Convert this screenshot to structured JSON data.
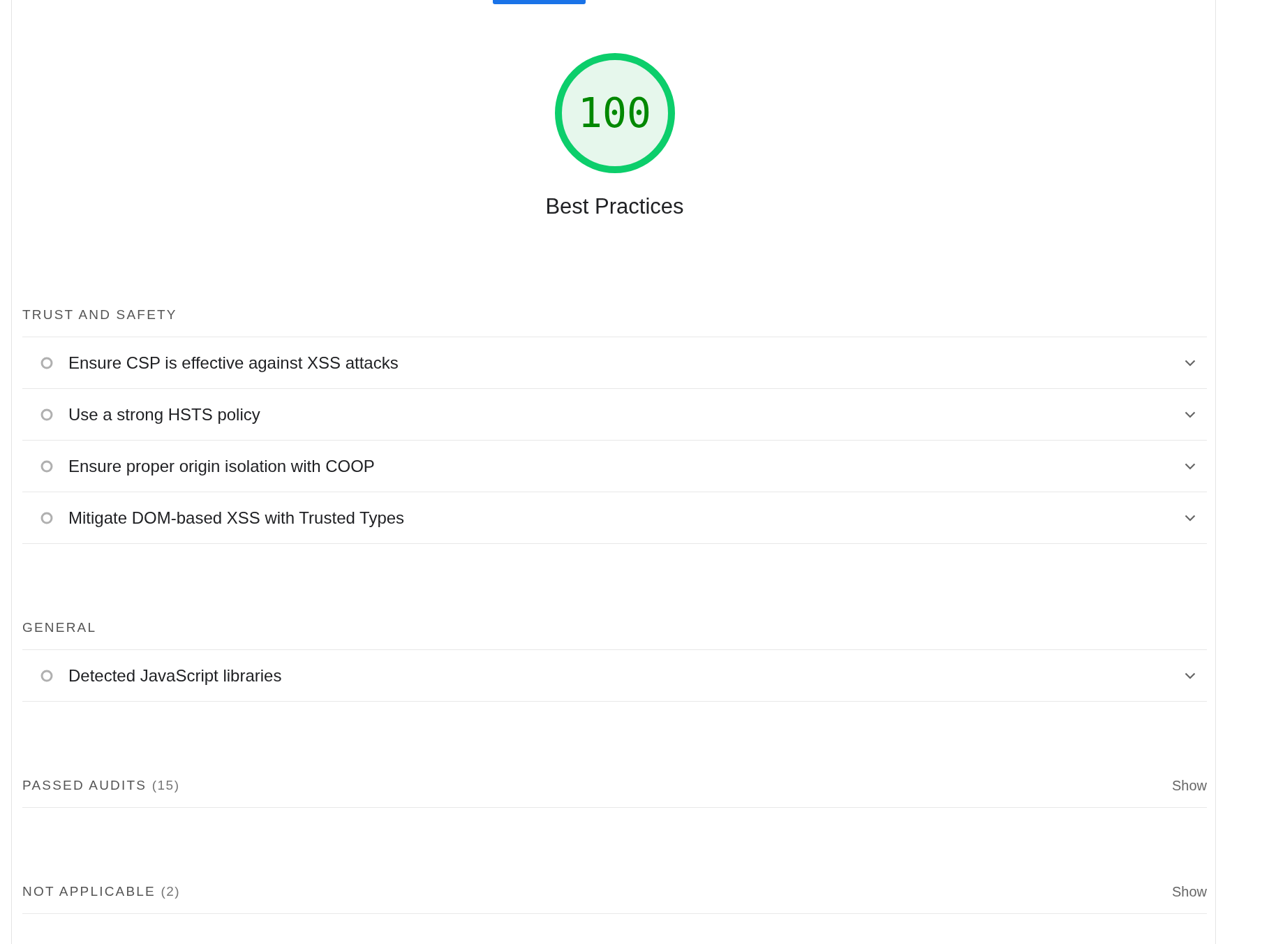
{
  "score": {
    "value": "100",
    "level": 1,
    "title": "Best Practices"
  },
  "sections": [
    {
      "kind": "audits",
      "title": "TRUST AND SAFETY",
      "audits": [
        {
          "title": "Ensure CSP is effective against XSS attacks"
        },
        {
          "title": "Use a strong HSTS policy"
        },
        {
          "title": "Ensure proper origin isolation with COOP"
        },
        {
          "title": "Mitigate DOM-based XSS with Trusted Types"
        }
      ]
    },
    {
      "kind": "audits",
      "title": "GENERAL",
      "audits": [
        {
          "title": "Detected JavaScript libraries"
        }
      ]
    },
    {
      "kind": "collapsed",
      "title": "PASSED AUDITS",
      "count": "(15)",
      "toggle": "Show"
    },
    {
      "kind": "collapsed",
      "title": "NOT APPLICABLE",
      "count": "(2)",
      "toggle": "Show"
    }
  ]
}
